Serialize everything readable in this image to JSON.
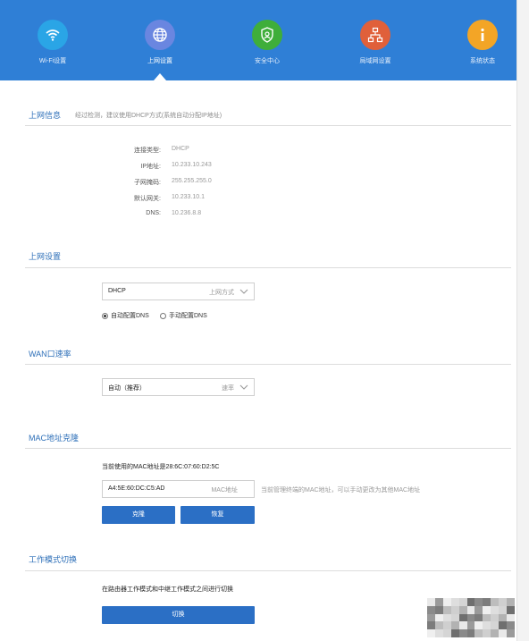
{
  "nav": {
    "items": [
      {
        "label": "Wi-Fi设置",
        "icon": "wifi-icon",
        "color": "#2aa5e6"
      },
      {
        "label": "上网设置",
        "icon": "globe-icon",
        "color": "#6a86e0"
      },
      {
        "label": "安全中心",
        "icon": "shield-icon",
        "color": "#3fae3a"
      },
      {
        "label": "局域网设置",
        "icon": "network-icon",
        "color": "#e0603a"
      },
      {
        "label": "系统状态",
        "icon": "info-icon",
        "color": "#f3a526"
      }
    ],
    "active_index": 1,
    "background": "#2f7fd6"
  },
  "internet_info": {
    "title": "上网信息",
    "hint": "经过检测，建议使用DHCP方式(系统自动分配IP地址)",
    "rows": [
      {
        "label": "连接类型:",
        "value": "DHCP"
      },
      {
        "label": "IP地址:",
        "value": "10.233.10.243"
      },
      {
        "label": "子网掩码:",
        "value": "255.255.255.0"
      },
      {
        "label": "默认网关:",
        "value": "10.233.10.1"
      },
      {
        "label": "DNS:",
        "value": "10.236.8.8"
      }
    ]
  },
  "internet_settings": {
    "title": "上网设置",
    "mode_value": "DHCP",
    "mode_hint": "上网方式",
    "dns_auto": "自动配置DNS",
    "dns_manual": "手动配置DNS"
  },
  "wan_speed": {
    "title": "WAN口速率",
    "value": "自动（推荐）",
    "hint": "速率"
  },
  "mac_clone": {
    "title": "MAC地址克隆",
    "current": "当前使用的MAC地址是28:6C:07:60:D2:5C",
    "input_value": "A4:5E:60:DC:C5:AD",
    "input_hint": "MAC地址",
    "help": "当前管理终端的MAC地址，可以手动更改为其他MAC地址",
    "clone_label": "克隆",
    "restore_label": "恢复"
  },
  "work_mode": {
    "title": "工作模式切换",
    "description": "在路由器工作模式和中继工作模式之间进行切换",
    "switch_label": "切换"
  },
  "colors": {
    "accent": "#2b6fc5",
    "section_title": "#2d6fb8"
  }
}
